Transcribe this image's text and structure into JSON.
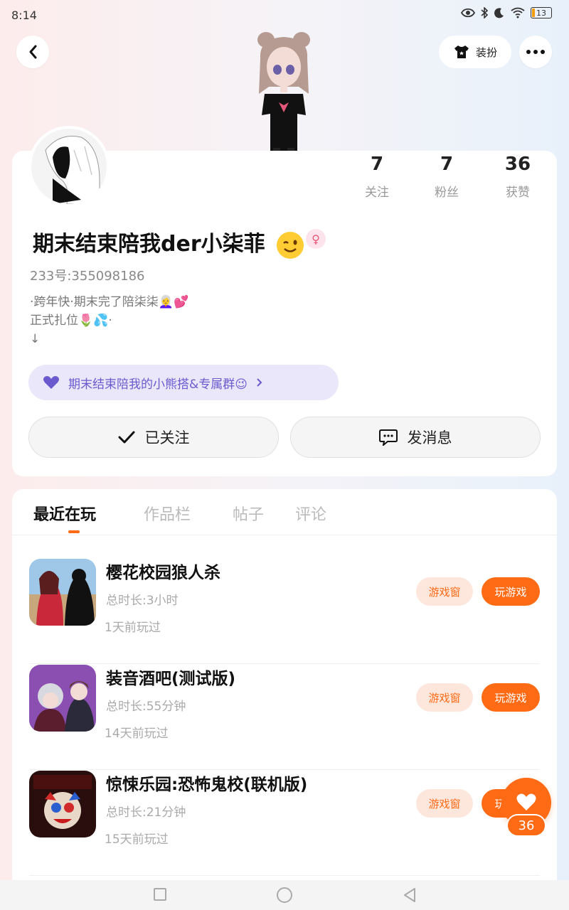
{
  "status_bar": {
    "time": "8:14",
    "battery_text": "13",
    "battery_level": 0.13
  },
  "header": {
    "back_icon": "chevron-left-icon",
    "dress_label": "装扮",
    "more_icon": "more-horizontal-icon"
  },
  "profile": {
    "nickname": "期末结束陪我der小柒菲",
    "gender_symbol": "♀",
    "uid": "233号:355098186",
    "bio_lines": [
      "·跨年快·期末完了陪柒柒👩‍🦳💕",
      "正式扎位🌷💦·",
      "↓"
    ],
    "group_link": "期末结束陪我的小熊搭&专属群😉"
  },
  "stats": [
    {
      "value": "7",
      "label": "关注"
    },
    {
      "value": "7",
      "label": "粉丝"
    },
    {
      "value": "36",
      "label": "获赞"
    }
  ],
  "actions": {
    "follow_label": "已关注",
    "message_label": "发消息"
  },
  "tabs": [
    "最近在玩",
    "作品栏",
    "帖子",
    "评论"
  ],
  "games": [
    {
      "name": "樱花校园狼人杀",
      "time": "总时长:3小时",
      "played": "1天前玩过",
      "store": "游戏窗",
      "play": "玩游戏"
    },
    {
      "name": "装音酒吧(测试版)",
      "time": "总时长:55分钟",
      "played": "14天前玩过",
      "store": "游戏窗",
      "play": "玩游戏"
    },
    {
      "name": "惊悚乐园:恐怖鬼校(联机版)",
      "time": "总时长:21分钟",
      "played": "15天前玩过",
      "store": "游戏窗",
      "play": "玩游戏"
    }
  ],
  "like_count": "36",
  "colors": {
    "accent": "#ff6a14",
    "accent_light": "#fde7dc",
    "chip_bg": "#ebe7fb",
    "chip_text": "#6a5acd"
  }
}
